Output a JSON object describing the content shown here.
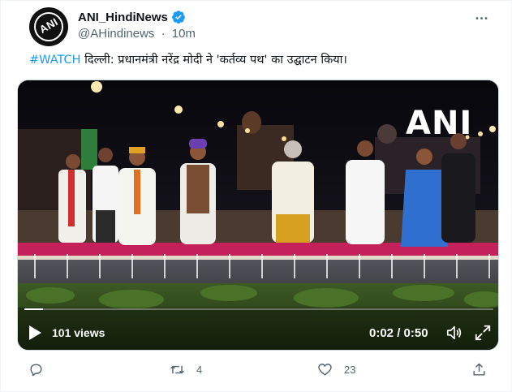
{
  "tweet": {
    "display_name": "ANI_HindiNews",
    "handle": "@AHindinews",
    "separator": "·",
    "time_ago": "10m",
    "hashtag": "#WATCH",
    "text": " दिल्ली: प्रधानमंत्री नरेंद्र मोदी ने 'कर्तव्य पथ' का उद्घाटन किया।",
    "avatar_label": "ANI"
  },
  "media": {
    "watermark": "ANI",
    "views": "101 views",
    "time": "0:02 / 0:50",
    "progress": 0.04
  },
  "actions": {
    "reply_count": "",
    "retweet_count": "4",
    "like_count": "23"
  },
  "colors": {
    "accent": "#1d9bf0",
    "muted": "#536471",
    "text": "#0f1419"
  },
  "icons": [
    "more-icon",
    "verified-icon",
    "play-icon",
    "volume-icon",
    "fullscreen-icon",
    "reply-icon",
    "retweet-icon",
    "like-icon",
    "share-icon"
  ]
}
